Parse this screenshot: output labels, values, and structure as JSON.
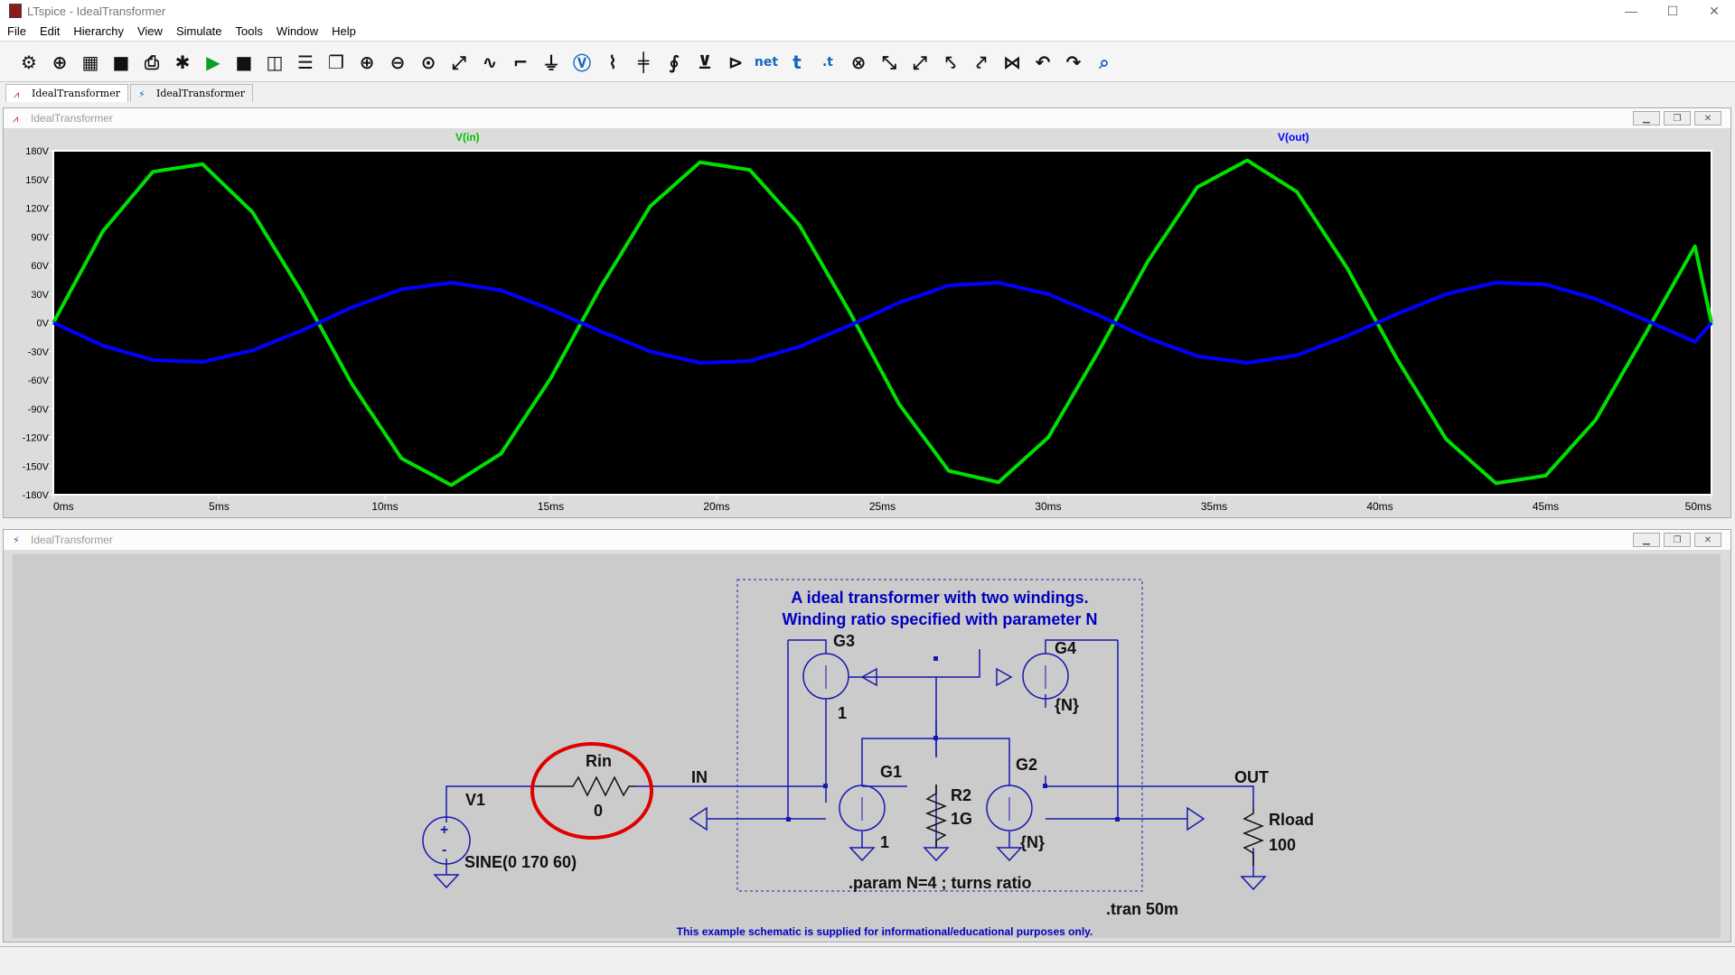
{
  "window": {
    "title": "LTspice - IdealTransformer",
    "controls": [
      "—",
      "☐",
      "✕"
    ]
  },
  "menu": [
    "File",
    "Edit",
    "Hierarchy",
    "View",
    "Simulate",
    "Tools",
    "Window",
    "Help"
  ],
  "toolbar": [
    {
      "name": "settings",
      "glyph": "⚙"
    },
    {
      "name": "new-schematic",
      "glyph": "⊕"
    },
    {
      "name": "open",
      "glyph": "▦"
    },
    {
      "name": "save",
      "glyph": "■"
    },
    {
      "name": "print",
      "glyph": "⎙"
    },
    {
      "name": "control-panel",
      "glyph": "✱"
    },
    {
      "name": "run",
      "glyph": "▶"
    },
    {
      "name": "halt",
      "glyph": "■"
    },
    {
      "name": "tile-vertical",
      "glyph": "◫"
    },
    {
      "name": "tile-horizontal",
      "glyph": "☰"
    },
    {
      "name": "cascade",
      "glyph": "❐"
    },
    {
      "name": "zoom-in",
      "glyph": "⊕"
    },
    {
      "name": "zoom-out",
      "glyph": "⊖"
    },
    {
      "name": "zoom-fit",
      "glyph": "⊙"
    },
    {
      "name": "autorange",
      "glyph": "⤢"
    },
    {
      "name": "fft",
      "glyph": "∿"
    },
    {
      "name": "wire",
      "glyph": "⌐"
    },
    {
      "name": "ground",
      "glyph": "⏚"
    },
    {
      "name": "voltage-source",
      "glyph": "Ⓥ"
    },
    {
      "name": "resistor",
      "glyph": "⌇"
    },
    {
      "name": "capacitor",
      "glyph": "╪"
    },
    {
      "name": "inductor",
      "glyph": "∮"
    },
    {
      "name": "diode",
      "glyph": "⊻"
    },
    {
      "name": "component",
      "glyph": "⊳"
    },
    {
      "name": "label-net",
      "glyph": "net"
    },
    {
      "name": "text",
      "glyph": "t"
    },
    {
      "name": "spice-directive",
      "glyph": ".t"
    },
    {
      "name": "delete",
      "glyph": "⊗"
    },
    {
      "name": "copy",
      "glyph": "⤡"
    },
    {
      "name": "move",
      "glyph": "⤢"
    },
    {
      "name": "drag",
      "glyph": "⤣"
    },
    {
      "name": "paste",
      "glyph": "⤤"
    },
    {
      "name": "mirror",
      "glyph": "⋈"
    },
    {
      "name": "undo",
      "glyph": "↶"
    },
    {
      "name": "redo",
      "glyph": "↷"
    },
    {
      "name": "find",
      "glyph": "⌕"
    }
  ],
  "tabs": [
    {
      "label": "IdealTransformer",
      "kind": "waveform"
    },
    {
      "label": "IdealTransformer",
      "kind": "schematic"
    }
  ],
  "waveform_window": {
    "title": "IdealTransformer"
  },
  "schematic_window": {
    "title": "IdealTransformer"
  },
  "chart_data": {
    "type": "line",
    "x": [
      0,
      1.5,
      3,
      4.5,
      6,
      7.5,
      9,
      10.5,
      12,
      13.5,
      15,
      16.5,
      18,
      19.5,
      21,
      22.5,
      24,
      25.5,
      27,
      28.5,
      30,
      31.5,
      33,
      34.5,
      36,
      37.5,
      39,
      40.5,
      42,
      43.5,
      45,
      46.5,
      48,
      49.5,
      50
    ],
    "xunit": "ms",
    "series": [
      {
        "name": "V(in)",
        "color": "#00e000",
        "values": [
          0,
          96,
          158,
          166,
          116,
          31,
          -64,
          -142,
          -170,
          -137,
          -58,
          37,
          122,
          168,
          160,
          102,
          12,
          -85,
          -155,
          -167,
          -120,
          -31,
          64,
          142,
          170,
          137,
          58,
          -37,
          -122,
          -168,
          -160,
          -102,
          -12,
          80,
          0
        ]
      },
      {
        "name": "V(out)",
        "color": "#0000ff",
        "values": [
          0,
          -24,
          -39,
          -41,
          -29,
          -8,
          16,
          35,
          42,
          34,
          14,
          -9,
          -30,
          -42,
          -40,
          -25,
          -3,
          21,
          39,
          42,
          30,
          8,
          -16,
          -35,
          -42,
          -34,
          -14,
          9,
          30,
          42,
          40,
          25,
          3,
          -20,
          0
        ]
      }
    ],
    "yticks": [
      "180V",
      "150V",
      "120V",
      "90V",
      "60V",
      "30V",
      "0V",
      "-30V",
      "-60V",
      "-90V",
      "-120V",
      "-150V",
      "-180V"
    ],
    "xticks": [
      "0ms",
      "5ms",
      "10ms",
      "15ms",
      "20ms",
      "25ms",
      "30ms",
      "35ms",
      "40ms",
      "45ms",
      "50ms"
    ],
    "ylim": [
      -180,
      180
    ],
    "xlim": [
      0,
      50
    ],
    "background": "#000000",
    "grid": false
  },
  "schematic": {
    "comment_title": "A ideal transformer with two windings.",
    "comment_sub": "Winding ratio specified with parameter N",
    "param": ".param N=4 ; turns ratio",
    "tran": ".tran 50m",
    "footer": "This example schematic is supplied for informational/educational purposes only.",
    "components": [
      {
        "ref": "V1",
        "value": "SINE(0 170 60)"
      },
      {
        "ref": "Rin",
        "value": "0"
      },
      {
        "ref": "G1",
        "value": "1"
      },
      {
        "ref": "G2",
        "value": "{N}"
      },
      {
        "ref": "G3",
        "value": "1"
      },
      {
        "ref": "G4",
        "value": "{N}"
      },
      {
        "ref": "R2",
        "value": "1G"
      },
      {
        "ref": "Rload",
        "value": "100"
      }
    ],
    "nets": [
      "IN",
      "OUT"
    ],
    "pins": [
      "+",
      "-"
    ],
    "wire_color": "#1818b0",
    "annotation_color": "#e00000"
  }
}
